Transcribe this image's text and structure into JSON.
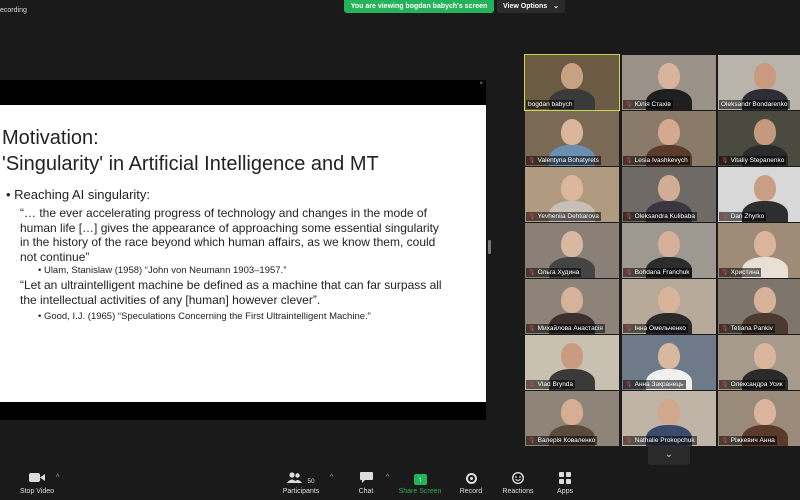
{
  "top": {
    "recording_label": "ecording",
    "viewing_banner": "You are viewing bogdan babych's screen",
    "view_options_label": "View Options",
    "view_options_caret": "⌄"
  },
  "slide": {
    "close_glyph": "×",
    "title_line1": "Motivation:",
    "title_line2": "'Singularity' in Artificial Intelligence and MT",
    "bullet": "• Reaching AI singularity:",
    "quote1": [
      "“… the ever accelerating progress of technology and changes in the mode of",
      "human life […] gives the appearance of approaching some essential singularity",
      "in the history of the race beyond which human affairs, as we know them, could",
      "not continue”"
    ],
    "ref1": "•  Ulam, Stanislaw (1958) “John von Neumann 1903–1957.”",
    "quote2": [
      "“Let an ultraintelligent machine be defined as a machine that can far surpass all",
      "the intellectual activities of any [human] however clever”."
    ],
    "ref2": "•  Good, I.J. (1965) “Speculations Concerning the First Ultraintelligent Machine.”"
  },
  "participants": [
    {
      "name": "bogdan babych",
      "muted": false,
      "bg": "#6b5a44",
      "skin": "#c9a183",
      "shirt": "#3a3a3a",
      "active": true
    },
    {
      "name": "Юлія Стахів",
      "muted": true,
      "bg": "#9a9188",
      "skin": "#d8b49c",
      "shirt": "#1f1f1f",
      "active": false
    },
    {
      "name": "Oleksandr Bondarenko",
      "muted": false,
      "bg": "#b8b3ab",
      "skin": "#c99a80",
      "shirt": "#2d2d35",
      "active": false
    },
    {
      "name": "Valentyna Bohatyrets",
      "muted": true,
      "bg": "#7a6a55",
      "skin": "#d9b59a",
      "shirt": "#6a8fb0",
      "active": false
    },
    {
      "name": "Lesia Ivashkevych",
      "muted": true,
      "bg": "#8a7a6a",
      "skin": "#d4a98e",
      "shirt": "#5a3a2a",
      "active": false
    },
    {
      "name": "Vitaliy Stepanenko",
      "muted": true,
      "bg": "#4a4a40",
      "skin": "#c49a7e",
      "shirt": "#2a2a2a",
      "active": false
    },
    {
      "name": "Yevheniia Dehtiarova",
      "muted": true,
      "bg": "#b09a80",
      "skin": "#ddb79c",
      "shirt": "#c8c0b6",
      "active": false
    },
    {
      "name": "Oleksandra Kulibaba",
      "muted": true,
      "bg": "#6f6a66",
      "skin": "#d2ad95",
      "shirt": "#3a3540",
      "active": false
    },
    {
      "name": "Dan Zhyrko",
      "muted": true,
      "bg": "#d8d8d8",
      "skin": "#c89f84",
      "shirt": "#2e2e2e",
      "active": false
    },
    {
      "name": "Ольга Худина",
      "muted": true,
      "bg": "#8a8078",
      "skin": "#d9b8a2",
      "shirt": "#444",
      "active": false
    },
    {
      "name": "Bohdana Franchuk",
      "muted": true,
      "bg": "#9d9890",
      "skin": "#d6b09a",
      "shirt": "#2c2c2c",
      "active": false
    },
    {
      "name": "Христина",
      "muted": true,
      "bg": "#a08a78",
      "skin": "#dcb49b",
      "shirt": "#e8e0d4",
      "active": false
    },
    {
      "name": "Михайлова Анастасія",
      "muted": true,
      "bg": "#8d8378",
      "skin": "#d7b29a",
      "shirt": "#3b2f2f",
      "active": false
    },
    {
      "name": "Інна Омельченко",
      "muted": true,
      "bg": "#b7aa9a",
      "skin": "#d9b49a",
      "shirt": "#2a2a2a",
      "active": false
    },
    {
      "name": "Tetiana Pankiv",
      "muted": true,
      "bg": "#7e756c",
      "skin": "#d8b39a",
      "shirt": "#4a3a30",
      "active": false
    },
    {
      "name": "Vlad Brynda",
      "muted": true,
      "bg": "#c8c0b0",
      "skin": "#c89b7e",
      "shirt": "#3a3a3a",
      "active": false
    },
    {
      "name": "Анна Закранець",
      "muted": true,
      "bg": "#6e7a88",
      "skin": "#d9b8a0",
      "shirt": "#f0f0f0",
      "active": false
    },
    {
      "name": "Олександра Усик",
      "muted": true,
      "bg": "#a59a8c",
      "skin": "#dab59c",
      "shirt": "#2a2a2a",
      "active": false
    },
    {
      "name": "Валерія Коваленко",
      "muted": true,
      "bg": "#8e8478",
      "skin": "#d6ae94",
      "shirt": "#5a4a3a",
      "active": false
    },
    {
      "name": "Nathalie Prokopchuk",
      "muted": true,
      "bg": "#bfb4a5",
      "skin": "#d0a88e",
      "shirt": "#3a4a6a",
      "active": false
    },
    {
      "name": "Ріжкевич Анна",
      "muted": true,
      "bg": "#9a8a7a",
      "skin": "#dab49c",
      "shirt": "#5a3a2a",
      "active": false
    }
  ],
  "gallery_next_glyph": "⌄",
  "toolbar": {
    "stop_video": "Stop Video",
    "participants": "Participants",
    "participants_count": "50",
    "chat": "Chat",
    "share_screen": "Share Screen",
    "record": "Record",
    "reactions": "Reactions",
    "apps": "Apps",
    "caret": "^"
  },
  "colors": {
    "share_green": "#24b35a",
    "mute_red": "#e0443a",
    "active_outline": "#c7d84a"
  }
}
